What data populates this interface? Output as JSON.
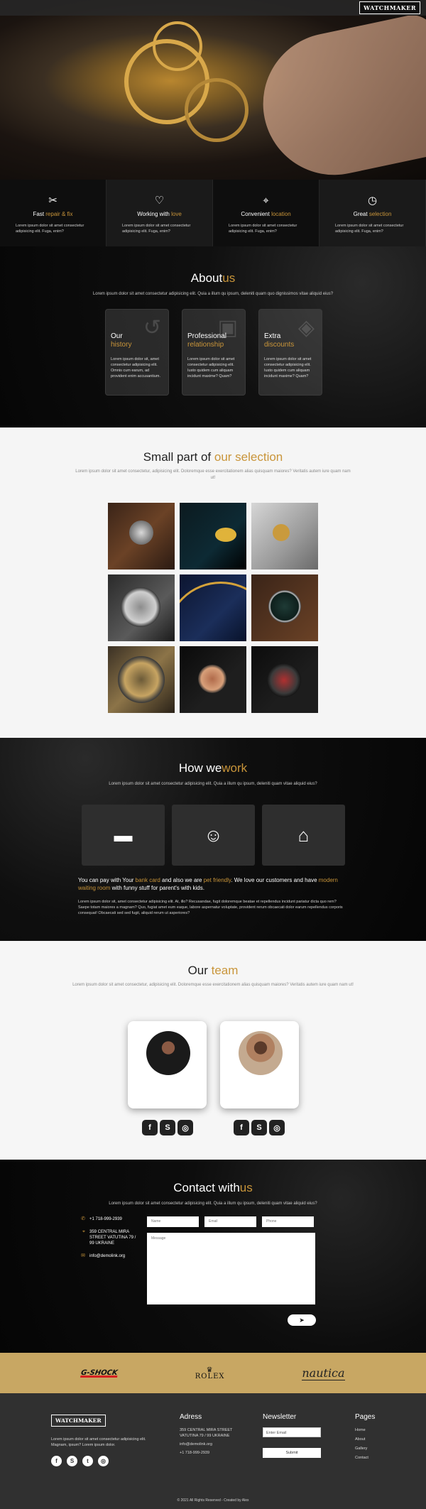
{
  "header": {
    "logo": "WATCHMAKER"
  },
  "features": [
    {
      "icon": "tools-icon",
      "glyph": "✂",
      "title_a": "Fast",
      "title_b": " repair & fix",
      "text": "Lorem ipsum dolor sit amet consectetur adipisicing elit. Fuga, enim?"
    },
    {
      "icon": "heart-icon",
      "glyph": "♡",
      "title_a": "Working with",
      "title_b": " love",
      "text": "Lorem ipsum dolor sit amet consectetur adipisicing elit. Fuga, enim?"
    },
    {
      "icon": "map-icon",
      "glyph": "⌖",
      "title_a": "Convenient",
      "title_b": " location",
      "text": "Lorem ipsum dolor sit amet consectetur adipisicing elit. Fuga, enim?"
    },
    {
      "icon": "clock-icon",
      "glyph": "◷",
      "title_a": "Great",
      "title_b": " selection",
      "text": "Lorem ipsum dolor sit amet consectetur adipisicing elit. Fuga, enim?"
    }
  ],
  "about": {
    "title_a": "About",
    "title_b": "us",
    "subtitle": "Lorem ipsum dolor sit amet consectetur adipisicing elit. Quia a illum qu ipsum, deleniti quam quo dignissimos vitae aliquid eius?",
    "cards": [
      {
        "l1": "Our",
        "l2": "history",
        "text": "Lorem ipsum dolor sit, amet consectetur adipisicing elit. Omnis cum earum, ad provident enim accusantium."
      },
      {
        "l1": "Professional",
        "l2": "relationship",
        "text": "Lorem ipsum dolor sit amet consectetur adipisicing elit. Iusto quidem cum aliquam incidunt maxime? Quam?"
      },
      {
        "l1": "Extra",
        "l2": "discounts",
        "text": "Lorem ipsum dolor sit amet consectetur adipisicing elit. Iusto quidem cum aliquam incidunt maxime? Quam?"
      }
    ]
  },
  "selection": {
    "title_a": "Small part of ",
    "title_b": "our selection",
    "subtitle": "Lorem ipsum dolor sit amet consectetur, adipisicing elit. Doloremque esse exercitationem alias quisquam maiores? Veritatis autem iure quam nam ut!"
  },
  "how": {
    "title_a": "How we",
    "title_b": "work",
    "subtitle": "Lorem ipsum dolor sit amet consectetur adipisicing elit. Quia a illum qu ipsum, deleniti quam vitae aliquid eius?",
    "cards": [
      "credit-card-icon",
      "smile-icon",
      "sofa-icon"
    ],
    "p1": "You can pay with Your ",
    "p1_gold": "bank card",
    "p2": " and also we are ",
    "p2_gold": "pet friendly",
    "p3": ". We love our customers and have ",
    "p3_gold": "modern waiting room",
    "p4": " with funny stuff for parent's with kids.",
    "text": "Lorem ipsum dolor sit, amet consectetur adipisicing elit. At, illo? Recusandae, fugit doloremque beatae et repellendus incidunt pariatur dicta quo rem? Saepe totam maiores a magnam? Quo, fugiat amet eum eaque, labore aspernatur voluptate, provident rerum obcaecati dolor earum repellendus corporis consequat! Obcaecati sed sed fugit, aliquid rerum ut asperiores?"
  },
  "team": {
    "title_a": "Our ",
    "title_b": "team",
    "subtitle": "Lorem ipsum dolor sit amet consectetur, adipisicing elit. Doloremque esse exercitationem alias quisquam maiores? Veritatis autem iure quam nam ut!"
  },
  "contact": {
    "title_a": "Contact with",
    "title_b": "us",
    "subtitle": "Lorem ipsum dolor sit amet consectetur adipisicing elit. Quia a illum qu ipsum, deleniti quam vitae aliquid eius?",
    "phone": "+1 718-999-2939",
    "address": "359 CENTRAL MIRA STREET VATUTINA 79 / 99 UKRAINE",
    "email": "info@demolink.org",
    "name_ph": "Name",
    "email_ph": "Email",
    "phone_ph": "Phone",
    "message_ph": "Message",
    "send_glyph": "➤"
  },
  "brands": {
    "b1": "G-SHOCK",
    "b2_crown": "♛",
    "b2": "ROLEX",
    "b3": "nautica"
  },
  "footer": {
    "logo": "WATCHMAKER",
    "desc": "Lorem ipsum dolor sit amet consectetur adipisicing elit. Magnam, ipsum? Lorem ipsum dolor.",
    "address_title": "Adress",
    "address": "359 CENTRAL MIRA STREET VATUTINA 79 / 99 UKRAINE",
    "email": "info@demolink.org",
    "phone": "+1 718-999-2939",
    "newsletter_title": "Newsletter",
    "email_ph": "Enter Email",
    "submit": "Submit",
    "pages_title": "Pages",
    "pages": [
      "Home",
      "About",
      "Gallery",
      "Contact"
    ],
    "copyright": "© 2021 All Rights Reserved - Created by Alex"
  }
}
